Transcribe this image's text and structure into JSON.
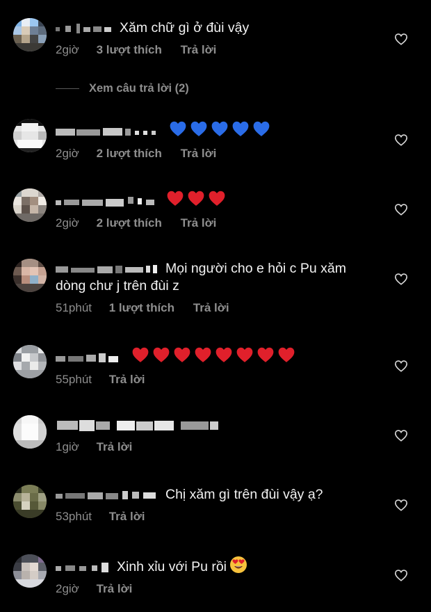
{
  "view_replies_label": "Xem câu trả lời (2)",
  "comments": [
    {
      "text": "Xăm chữ gì ở đùi vậy",
      "text2": "",
      "time": "2giờ",
      "likes": "3 lượt thích",
      "reply": "Trả lời",
      "emoji": "",
      "emoji_count": 0
    },
    {
      "text": "",
      "text2": "",
      "time": "2giờ",
      "likes": "2 lượt thích",
      "reply": "Trả lời",
      "emoji": "blue-heart",
      "emoji_count": 5
    },
    {
      "text": "",
      "text2": "",
      "time": "2giờ",
      "likes": "2 lượt thích",
      "reply": "Trả lời",
      "emoji": "red-heart",
      "emoji_count": 3
    },
    {
      "text": "Mọi người cho e hỏi c Pu xăm",
      "text2": "dòng chư j trên đùi z",
      "time": "51phút",
      "likes": "1 lượt thích",
      "reply": "Trả lời",
      "emoji": "",
      "emoji_count": 0
    },
    {
      "text": "",
      "text2": "",
      "time": "55phút",
      "likes": "",
      "reply": "Trả lời",
      "emoji": "red-heart",
      "emoji_count": 8
    },
    {
      "text": "",
      "text2": "",
      "time": "1giờ",
      "likes": "",
      "reply": "Trả lời",
      "emoji": "",
      "emoji_count": 0
    },
    {
      "text": "Chị xăm gì trên đùi vậy ạ?",
      "text2": "",
      "time": "53phút",
      "likes": "",
      "reply": "Trả lời",
      "emoji": "",
      "emoji_count": 0
    },
    {
      "text": "Xinh xỉu với Pu rồi",
      "text2": "",
      "time": "2giờ",
      "likes": "",
      "reply": "Trả lời",
      "emoji": "heart-eyes",
      "emoji_count": 1
    }
  ],
  "colors": {
    "background": "#000000",
    "text": "#f2f2f2",
    "meta": "#8e8e8e",
    "red_heart": "#e0202b",
    "blue_heart": "#2a6ce8"
  },
  "icons": {
    "like": "heart-outline-icon"
  }
}
